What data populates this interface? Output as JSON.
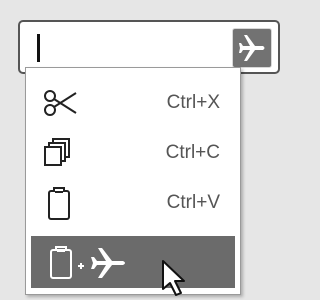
{
  "colors": {
    "background": "#e6e6e6",
    "field_border": "#555555",
    "button_fill": "#727272",
    "highlight_fill": "#6b6b6b",
    "shortcut_text": "#555555"
  },
  "input": {
    "value": "",
    "go_button_icon": "airplane-icon"
  },
  "context_menu": {
    "items": [
      {
        "action": "cut",
        "icon": "scissors-icon",
        "shortcut": "Ctrl+X"
      },
      {
        "action": "copy",
        "icon": "copy-icon",
        "shortcut": "Ctrl+C"
      },
      {
        "action": "paste",
        "icon": "clipboard-icon",
        "shortcut": "Ctrl+V"
      },
      {
        "action": "paste-and-go",
        "icon": "clipboard-plus-airplane-icon",
        "highlighted": true
      }
    ]
  }
}
